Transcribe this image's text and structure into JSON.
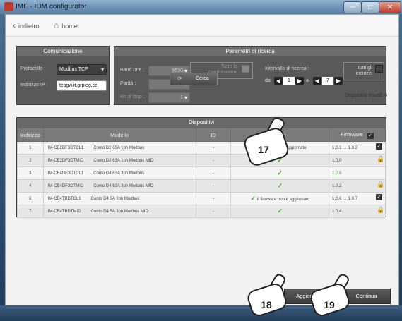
{
  "window": {
    "title": "IME - IDM configurator",
    "min_glyph": "─",
    "max_glyph": "□",
    "close_glyph": "✕"
  },
  "nav": {
    "back_label": "indietro",
    "home_label": "home"
  },
  "comunicazione": {
    "title": "Comunicazione",
    "protocol_label": "Protocollo :",
    "protocol_value": "Modbus TCP",
    "ip_label": "Indirizzo IP :",
    "ip_value": "tcpgw.it.grpleg.co"
  },
  "ricerca": {
    "title": "Parametri di ricerca",
    "baud_label": "Baud rate :",
    "baud_value": "9600",
    "parity_label": "Parità :",
    "parity_value": "even",
    "stopbit_label": "Bit di stop :",
    "stopbit_value": "1",
    "all_combos_label": "Tutte le combinazioni",
    "interval_label": "Intervallo di ricerca :",
    "da_label": "da",
    "a_label": "a",
    "from_value": "1",
    "to_value": "7",
    "all_addresses_label": "tutti gli indirizzi",
    "search_button": "Cerca",
    "devices_found": "Dispositivi trovati: 6"
  },
  "dispositivi": {
    "title": "Dispositivi",
    "columns": [
      "Indirizzo",
      "Modello",
      "ID",
      "Esito",
      "Firmware"
    ],
    "rows": [
      {
        "addr": "1",
        "code": "IM-CE2DF3DTCL1",
        "model": "Conto D2 63A 1ph Modbus",
        "id": "-",
        "esito": "Il firmware non è aggiornato",
        "esito_ok": false,
        "fw": "1.0.1 → 1.0.2",
        "fw_icon": "checkbox-icon"
      },
      {
        "addr": "2",
        "code": "IM-CE2DF3DTMID",
        "model": "Conto D2 63A 1ph Modbus MID",
        "id": "-",
        "esito": "",
        "esito_ok": true,
        "fw": "1.0.0",
        "fw_icon": "lock-icon"
      },
      {
        "addr": "3",
        "code": "IM-CE4DF3DTCL1",
        "model": "Conto D4 63A 3ph Modbus",
        "id": "-",
        "esito": "",
        "esito_ok": true,
        "fw": "1.0.6",
        "fw_icon": "none"
      },
      {
        "addr": "4",
        "code": "IM-CE4DF3DTMID",
        "model": "Conto D4 63A 3ph Modbus MID",
        "id": "-",
        "esito": "",
        "esito_ok": true,
        "fw": "1.0.2",
        "fw_icon": "lock-icon"
      },
      {
        "addr": "6",
        "code": "IM-CE4TBDTCL1",
        "model": "Conto D4 5A 3ph Modbus",
        "id": "-",
        "esito": "Il firmware non è aggiornato",
        "esito_ok": true,
        "fw": "1.0.6 → 1.0.7",
        "fw_icon": "checkbox-icon"
      },
      {
        "addr": "7",
        "code": "IM-CE4TBDTMID",
        "model": "Conto D4 5A 3ph Modbus MID",
        "id": "-",
        "esito": "",
        "esito_ok": true,
        "fw": "1.0.4",
        "fw_icon": "lock-icon"
      }
    ]
  },
  "buttons": {
    "update": "AggiornaF",
    "continue": "Continua"
  },
  "callouts": {
    "c17": "17",
    "c18": "18",
    "c19": "19"
  },
  "colors": {
    "accent_green": "#41b02a",
    "panel": "#595959"
  }
}
